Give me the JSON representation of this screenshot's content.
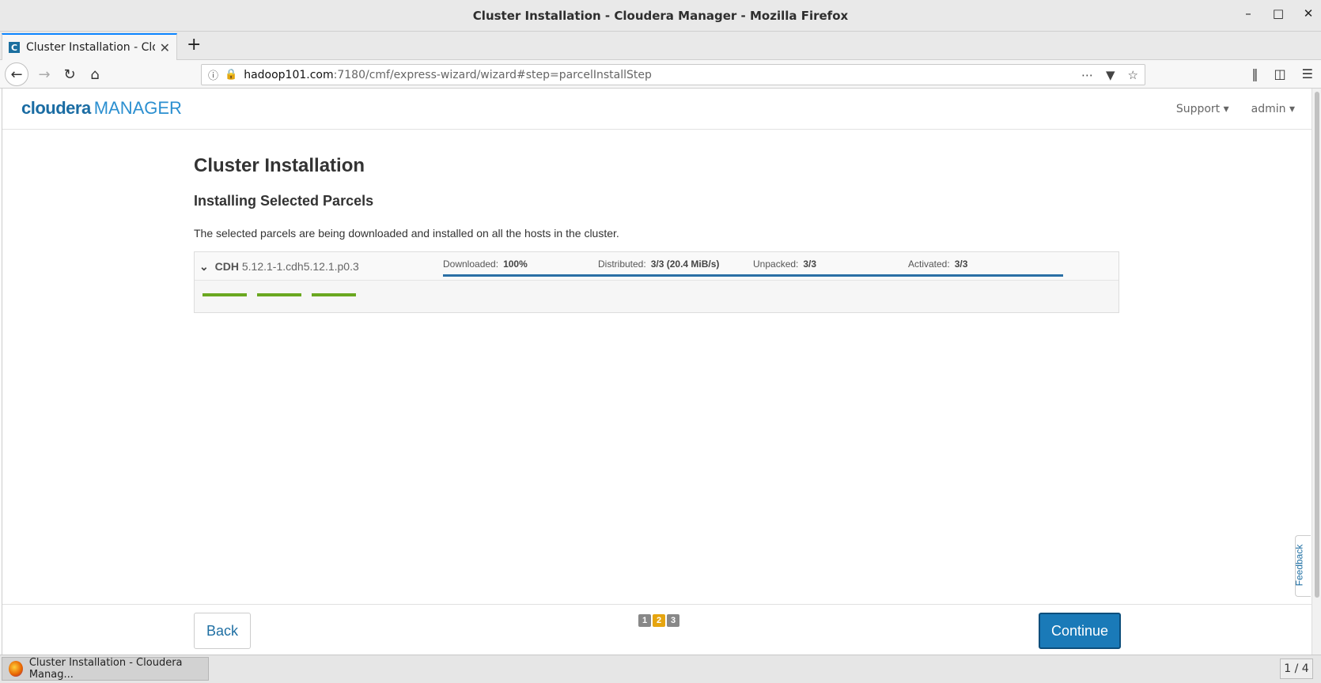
{
  "window": {
    "title": "Cluster Installation - Cloudera Manager - Mozilla Firefox"
  },
  "browser": {
    "tab_label": "Cluster Installation - Clou",
    "url_host": "hadoop101.com",
    "url_path": ":7180/cmf/express-wizard/wizard#step=parcelInstallStep"
  },
  "header": {
    "brand": "cloudera",
    "product": "MANAGER",
    "menus": [
      "Support",
      "admin"
    ]
  },
  "main": {
    "title": "Cluster Installation",
    "subtitle": "Installing Selected Parcels",
    "description": "The selected parcels are being downloaded and installed on all the hosts in the cluster."
  },
  "parcel": {
    "name": "CDH",
    "version": "5.12.1-1.cdh5.12.1.p0.3",
    "stats": [
      {
        "label": "Downloaded:",
        "value": "100%",
        "progress": 1.0
      },
      {
        "label": "Distributed:",
        "value": "3/3 (20.4 MiB/s)",
        "progress": 1.0
      },
      {
        "label": "Unpacked:",
        "value": "3/3",
        "progress": 1.0
      },
      {
        "label": "Activated:",
        "value": "3/3",
        "progress": 1.0
      }
    ],
    "host_count": 3,
    "bar_color": "#2a6fa5",
    "host_bar_color": "#6aa820"
  },
  "footer": {
    "back_label": "Back",
    "continue_label": "Continue",
    "steps": [
      "1",
      "2",
      "3"
    ],
    "active_step": 2
  },
  "feedback_label": "Feedback",
  "taskbar": {
    "item_label": "Cluster Installation - Cloudera Manag...",
    "pager": "1 / 4"
  }
}
